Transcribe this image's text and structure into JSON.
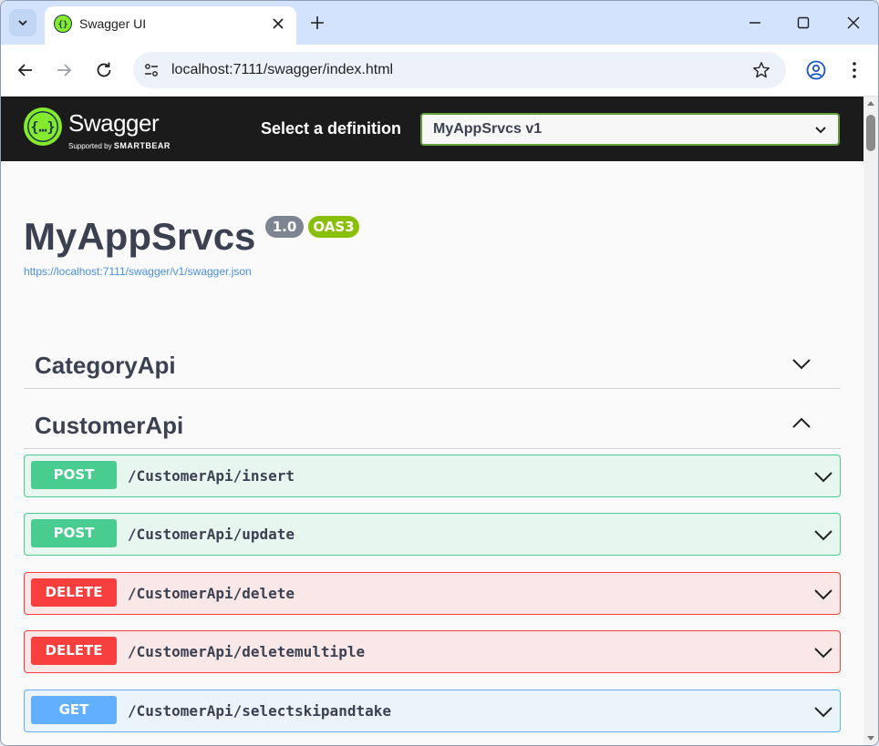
{
  "browser": {
    "tab_title": "Swagger UI",
    "url": "localhost:7111/swagger/index.html"
  },
  "swagger": {
    "logo_text": "Swagger",
    "logo_sub_prefix": "Supported by",
    "logo_sub_brand": "SMARTBEAR",
    "select_label": "Select a definition",
    "selected_definition": "MyAppSrvcs v1"
  },
  "info": {
    "title": "MyAppSrvcs",
    "version": "1.0",
    "oas": "OAS3",
    "spec_url": "https://localhost:7111/swagger/v1/swagger.json"
  },
  "tags": [
    {
      "name": "CategoryApi",
      "expanded": false
    },
    {
      "name": "CustomerApi",
      "expanded": true
    }
  ],
  "operations": [
    {
      "method": "POST",
      "path": "/CustomerApi/insert"
    },
    {
      "method": "POST",
      "path": "/CustomerApi/update"
    },
    {
      "method": "DELETE",
      "path": "/CustomerApi/delete"
    },
    {
      "method": "DELETE",
      "path": "/CustomerApi/deletemultiple"
    },
    {
      "method": "GET",
      "path": "/CustomerApi/selectskipandtake"
    }
  ],
  "colors": {
    "post": "#49cc90",
    "delete": "#f93e3e",
    "get": "#61affe",
    "swagger_green": "#85ea2d"
  }
}
